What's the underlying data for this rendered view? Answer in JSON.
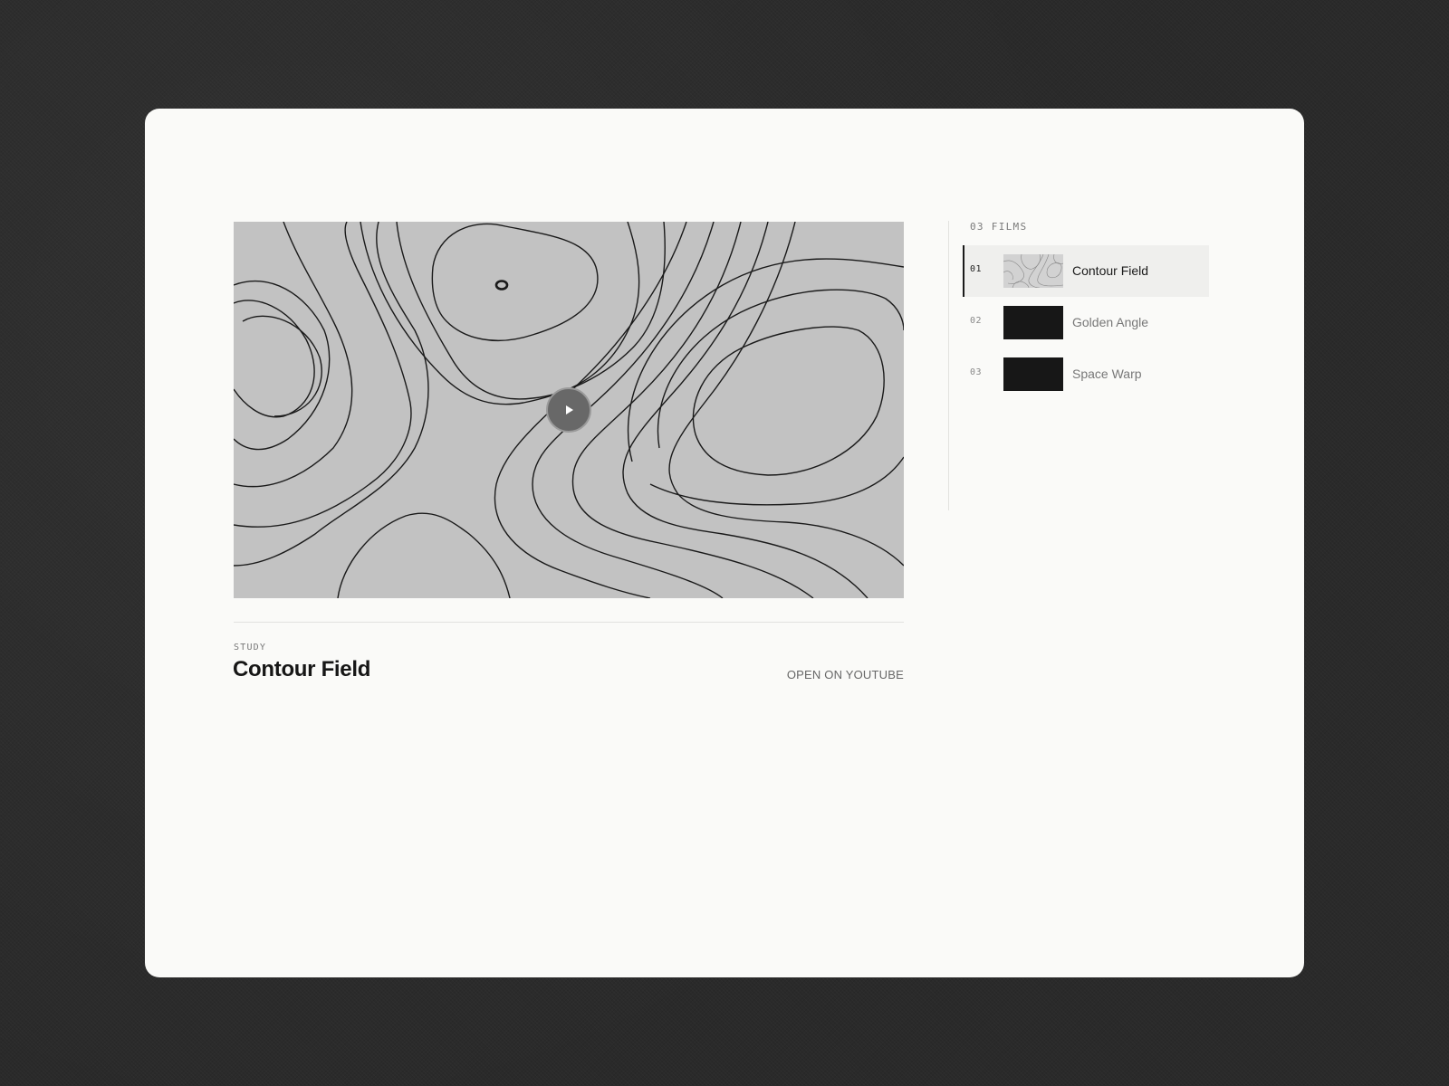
{
  "player": {
    "now_playing": {
      "eyebrow": "STUDY",
      "title": "Contour Field",
      "external_link": "OPEN ON YOUTUBE"
    }
  },
  "playlist": {
    "header": "03 FILMS",
    "items": [
      {
        "number": "01",
        "label": "Contour Field",
        "active": true
      },
      {
        "number": "02",
        "label": "Golden Angle",
        "active": false
      },
      {
        "number": "03",
        "label": "Space Warp",
        "active": false
      }
    ]
  },
  "icons": {
    "play": "play-icon"
  },
  "colors": {
    "page_background": "#2a2a2a",
    "card_background": "#fafaf8",
    "video_background": "#c2c2c2",
    "contour_line": "#1a1a1a",
    "active_item_background": "#efefed",
    "text_primary": "#161616",
    "text_muted": "#777777"
  }
}
